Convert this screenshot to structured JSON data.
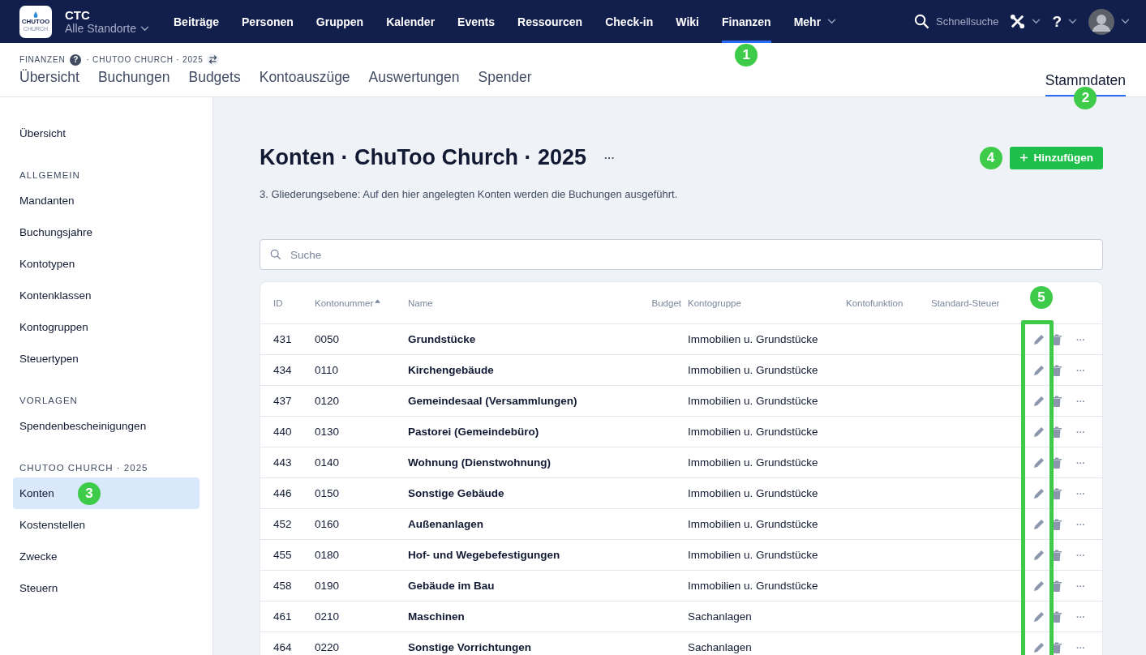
{
  "topbar": {
    "logo": {
      "name": "CHUTOO",
      "sub": "CHURCH"
    },
    "org": "CTC",
    "location": "Alle Standorte",
    "nav": [
      {
        "label": "Beiträge",
        "selected": false
      },
      {
        "label": "Personen",
        "selected": false
      },
      {
        "label": "Gruppen",
        "selected": false
      },
      {
        "label": "Kalender",
        "selected": false
      },
      {
        "label": "Events",
        "selected": false
      },
      {
        "label": "Ressourcen",
        "selected": false
      },
      {
        "label": "Check-in",
        "selected": false
      },
      {
        "label": "Wiki",
        "selected": false
      },
      {
        "label": "Finanzen",
        "selected": true,
        "marker": "1"
      }
    ],
    "more": "Mehr",
    "search": {
      "placeholder": "Schnellsuche"
    },
    "help": "?"
  },
  "subheader": {
    "breadcrumb": [
      "FINANZEN",
      "· CHUTOO CHURCH · 2025"
    ],
    "help": "?",
    "tabs": [
      {
        "label": "Übersicht",
        "selected": false
      },
      {
        "label": "Buchungen",
        "selected": false
      },
      {
        "label": "Budgets",
        "selected": false
      },
      {
        "label": "Kontoauszüge",
        "selected": false
      },
      {
        "label": "Auswertungen",
        "selected": false
      },
      {
        "label": "Spender",
        "selected": false
      }
    ],
    "right_tab": {
      "label": "Stammdaten",
      "selected": true,
      "marker": "2"
    }
  },
  "sidebar": {
    "sections": [
      {
        "items": [
          {
            "label": "Übersicht",
            "selected": false
          }
        ]
      },
      {
        "title": "ALLGEMEIN",
        "items": [
          {
            "label": "Mandanten",
            "selected": false
          },
          {
            "label": "Buchungsjahre",
            "selected": false
          },
          {
            "label": "Kontotypen",
            "selected": false
          },
          {
            "label": "Kontenklassen",
            "selected": false
          },
          {
            "label": "Kontogruppen",
            "selected": false
          },
          {
            "label": "Steuertypen",
            "selected": false
          }
        ]
      },
      {
        "title": "VORLAGEN",
        "items": [
          {
            "label": "Spendenbescheinigungen",
            "selected": false
          }
        ]
      },
      {
        "title": "CHUTOO CHURCH · 2025",
        "items": [
          {
            "label": "Konten",
            "selected": true,
            "marker": "3"
          },
          {
            "label": "Kostenstellen",
            "selected": false
          },
          {
            "label": "Zwecke",
            "selected": false
          },
          {
            "label": "Steuern",
            "selected": false
          }
        ]
      }
    ]
  },
  "main": {
    "title": "Konten · ChuToo Church · 2025",
    "more": "···",
    "description": "3. Gliederungsebene: Auf den hier angelegten Konten werden die Buchungen ausgeführt.",
    "add_button": {
      "label": "Hinzufügen",
      "marker": "4"
    },
    "search": {
      "placeholder": "Suche"
    },
    "table": {
      "columns": [
        {
          "label": "ID",
          "sorted": false
        },
        {
          "label": "Kontonummer",
          "sorted": true
        },
        {
          "label": "Name",
          "sorted": false
        },
        {
          "label": "Budget",
          "sorted": false
        },
        {
          "label": "Kontogruppe",
          "sorted": false
        },
        {
          "label": "Kontofunktion",
          "sorted": false
        },
        {
          "label": "Standard-Steuer",
          "sorted": false
        }
      ],
      "actions_marker": "5",
      "row_more": "···",
      "rows": [
        {
          "id": "431",
          "number": "0050",
          "name": "Grundstücke",
          "group": "Immobilien u. Grundstücke"
        },
        {
          "id": "434",
          "number": "0110",
          "name": "Kirchengebäude",
          "group": "Immobilien u. Grundstücke"
        },
        {
          "id": "437",
          "number": "0120",
          "name": "Gemeindesaal (Versammlungen)",
          "group": "Immobilien u. Grundstücke"
        },
        {
          "id": "440",
          "number": "0130",
          "name": "Pastorei (Gemeindebüro)",
          "group": "Immobilien u. Grundstücke"
        },
        {
          "id": "443",
          "number": "0140",
          "name": "Wohnung (Dienstwohnung)",
          "group": "Immobilien u. Grundstücke"
        },
        {
          "id": "446",
          "number": "0150",
          "name": "Sonstige Gebäude",
          "group": "Immobilien u. Grundstücke"
        },
        {
          "id": "452",
          "number": "0160",
          "name": "Außenanlagen",
          "group": "Immobilien u. Grundstücke"
        },
        {
          "id": "455",
          "number": "0180",
          "name": "Hof- und Wegebefestigungen",
          "group": "Immobilien u. Grundstücke"
        },
        {
          "id": "458",
          "number": "0190",
          "name": "Gebäude im Bau",
          "group": "Immobilien u. Grundstücke"
        },
        {
          "id": "461",
          "number": "0210",
          "name": "Maschinen",
          "group": "Sachanlagen"
        },
        {
          "id": "464",
          "number": "0220",
          "name": "Sonstige Vorrichtungen",
          "group": "Sachanlagen"
        }
      ]
    }
  }
}
